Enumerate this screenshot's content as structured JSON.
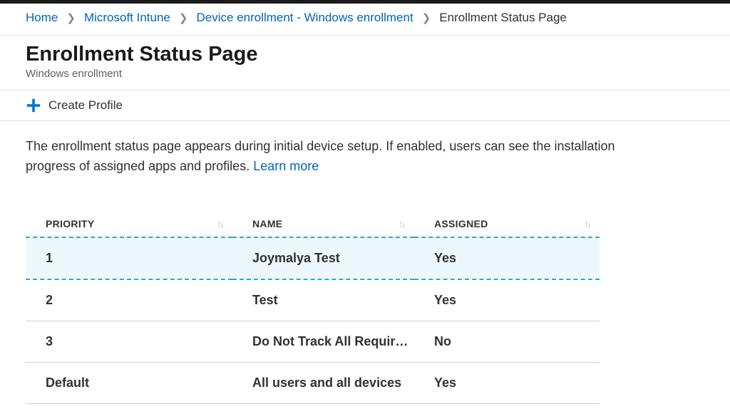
{
  "breadcrumbs": {
    "home": "Home",
    "intune": "Microsoft Intune",
    "enrollment": "Device enrollment - Windows enrollment",
    "current": "Enrollment Status Page"
  },
  "header": {
    "title": "Enrollment Status Page",
    "subtitle": "Windows enrollment"
  },
  "toolbar": {
    "create_profile": "Create Profile"
  },
  "description": {
    "text": "The enrollment status page appears during initial device setup. If enabled, users can see the installation progress of assigned apps and profiles. ",
    "learn_more": "Learn more"
  },
  "table": {
    "columns": {
      "priority": "PRIORITY",
      "name": "NAME",
      "assigned": "ASSIGNED"
    },
    "rows": [
      {
        "priority": "1",
        "name": "Joymalya Test",
        "assigned": "Yes",
        "highlight": true
      },
      {
        "priority": "2",
        "name": "Test",
        "assigned": "Yes",
        "highlight": false
      },
      {
        "priority": "3",
        "name": "Do Not Track All Require…",
        "assigned": "No",
        "highlight": false
      },
      {
        "priority": "Default",
        "name": "All users and all devices",
        "assigned": "Yes",
        "highlight": false
      }
    ]
  }
}
